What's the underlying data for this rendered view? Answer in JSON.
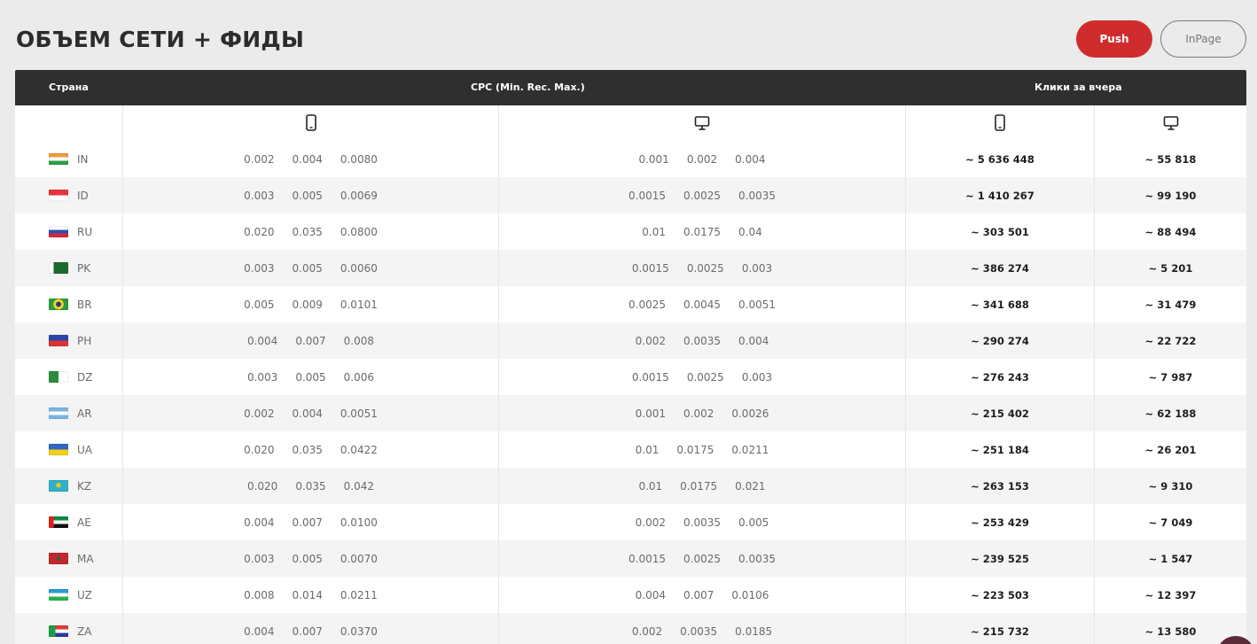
{
  "page": {
    "title": "ОБЪЕМ СЕТИ + ФИДЫ"
  },
  "tabs": {
    "push": "Push",
    "inpage": "InPage"
  },
  "table": {
    "headers": {
      "country": "Страна",
      "cpc": "CPC (Min. Rec. Max.)",
      "clicks": "Клики за вчера"
    },
    "device_icons": [
      "mobile-icon",
      "desktop-icon",
      "mobile-icon",
      "desktop-icon"
    ],
    "rows": [
      {
        "code": "IN",
        "flag": "flag-in-icon",
        "mob": [
          "0.002",
          "0.004",
          "0.0080"
        ],
        "desk": [
          "0.001",
          "0.002",
          "0.004"
        ],
        "clicks_mob": "~ 5 636 448",
        "clicks_desk": "~ 55 818"
      },
      {
        "code": "ID",
        "flag": "flag-id-icon",
        "mob": [
          "0.003",
          "0.005",
          "0.0069"
        ],
        "desk": [
          "0.0015",
          "0.0025",
          "0.0035"
        ],
        "clicks_mob": "~ 1 410 267",
        "clicks_desk": "~ 99 190"
      },
      {
        "code": "RU",
        "flag": "flag-ru-icon",
        "mob": [
          "0.020",
          "0.035",
          "0.0800"
        ],
        "desk": [
          "0.01",
          "0.0175",
          "0.04"
        ],
        "clicks_mob": "~ 303 501",
        "clicks_desk": "~ 88 494"
      },
      {
        "code": "PK",
        "flag": "flag-pk-icon",
        "mob": [
          "0.003",
          "0.005",
          "0.0060"
        ],
        "desk": [
          "0.0015",
          "0.0025",
          "0.003"
        ],
        "clicks_mob": "~ 386 274",
        "clicks_desk": "~ 5 201"
      },
      {
        "code": "BR",
        "flag": "flag-br-icon",
        "mob": [
          "0.005",
          "0.009",
          "0.0101"
        ],
        "desk": [
          "0.0025",
          "0.0045",
          "0.0051"
        ],
        "clicks_mob": "~ 341 688",
        "clicks_desk": "~ 31 479"
      },
      {
        "code": "PH",
        "flag": "flag-ph-icon",
        "mob": [
          "0.004",
          "0.007",
          "0.008"
        ],
        "desk": [
          "0.002",
          "0.0035",
          "0.004"
        ],
        "clicks_mob": "~ 290 274",
        "clicks_desk": "~ 22 722"
      },
      {
        "code": "DZ",
        "flag": "flag-dz-icon",
        "mob": [
          "0.003",
          "0.005",
          "0.006"
        ],
        "desk": [
          "0.0015",
          "0.0025",
          "0.003"
        ],
        "clicks_mob": "~ 276 243",
        "clicks_desk": "~ 7 987"
      },
      {
        "code": "AR",
        "flag": "flag-ar-icon",
        "mob": [
          "0.002",
          "0.004",
          "0.0051"
        ],
        "desk": [
          "0.001",
          "0.002",
          "0.0026"
        ],
        "clicks_mob": "~ 215 402",
        "clicks_desk": "~ 62 188"
      },
      {
        "code": "UA",
        "flag": "flag-ua-icon",
        "mob": [
          "0.020",
          "0.035",
          "0.0422"
        ],
        "desk": [
          "0.01",
          "0.0175",
          "0.0211"
        ],
        "clicks_mob": "~ 251 184",
        "clicks_desk": "~ 26 201"
      },
      {
        "code": "KZ",
        "flag": "flag-kz-icon",
        "mob": [
          "0.020",
          "0.035",
          "0.042"
        ],
        "desk": [
          "0.01",
          "0.0175",
          "0.021"
        ],
        "clicks_mob": "~ 263 153",
        "clicks_desk": "~ 9 310"
      },
      {
        "code": "AE",
        "flag": "flag-ae-icon",
        "mob": [
          "0.004",
          "0.007",
          "0.0100"
        ],
        "desk": [
          "0.002",
          "0.0035",
          "0.005"
        ],
        "clicks_mob": "~ 253 429",
        "clicks_desk": "~ 7 049"
      },
      {
        "code": "MA",
        "flag": "flag-ma-icon",
        "mob": [
          "0.003",
          "0.005",
          "0.0070"
        ],
        "desk": [
          "0.0015",
          "0.0025",
          "0.0035"
        ],
        "clicks_mob": "~ 239 525",
        "clicks_desk": "~ 1 547"
      },
      {
        "code": "UZ",
        "flag": "flag-uz-icon",
        "mob": [
          "0.008",
          "0.014",
          "0.0211"
        ],
        "desk": [
          "0.004",
          "0.007",
          "0.0106"
        ],
        "clicks_mob": "~ 223 503",
        "clicks_desk": "~ 12 397"
      },
      {
        "code": "ZA",
        "flag": "flag-za-icon",
        "mob": [
          "0.004",
          "0.007",
          "0.0370"
        ],
        "desk": [
          "0.002",
          "0.0035",
          "0.0185"
        ],
        "clicks_mob": "~ 215 732",
        "clicks_desk": "~ 13 580"
      }
    ]
  },
  "colors": {
    "accent": "#cf2d2d",
    "header_bg": "#2f2f2f",
    "page_bg": "#ebebeb"
  }
}
